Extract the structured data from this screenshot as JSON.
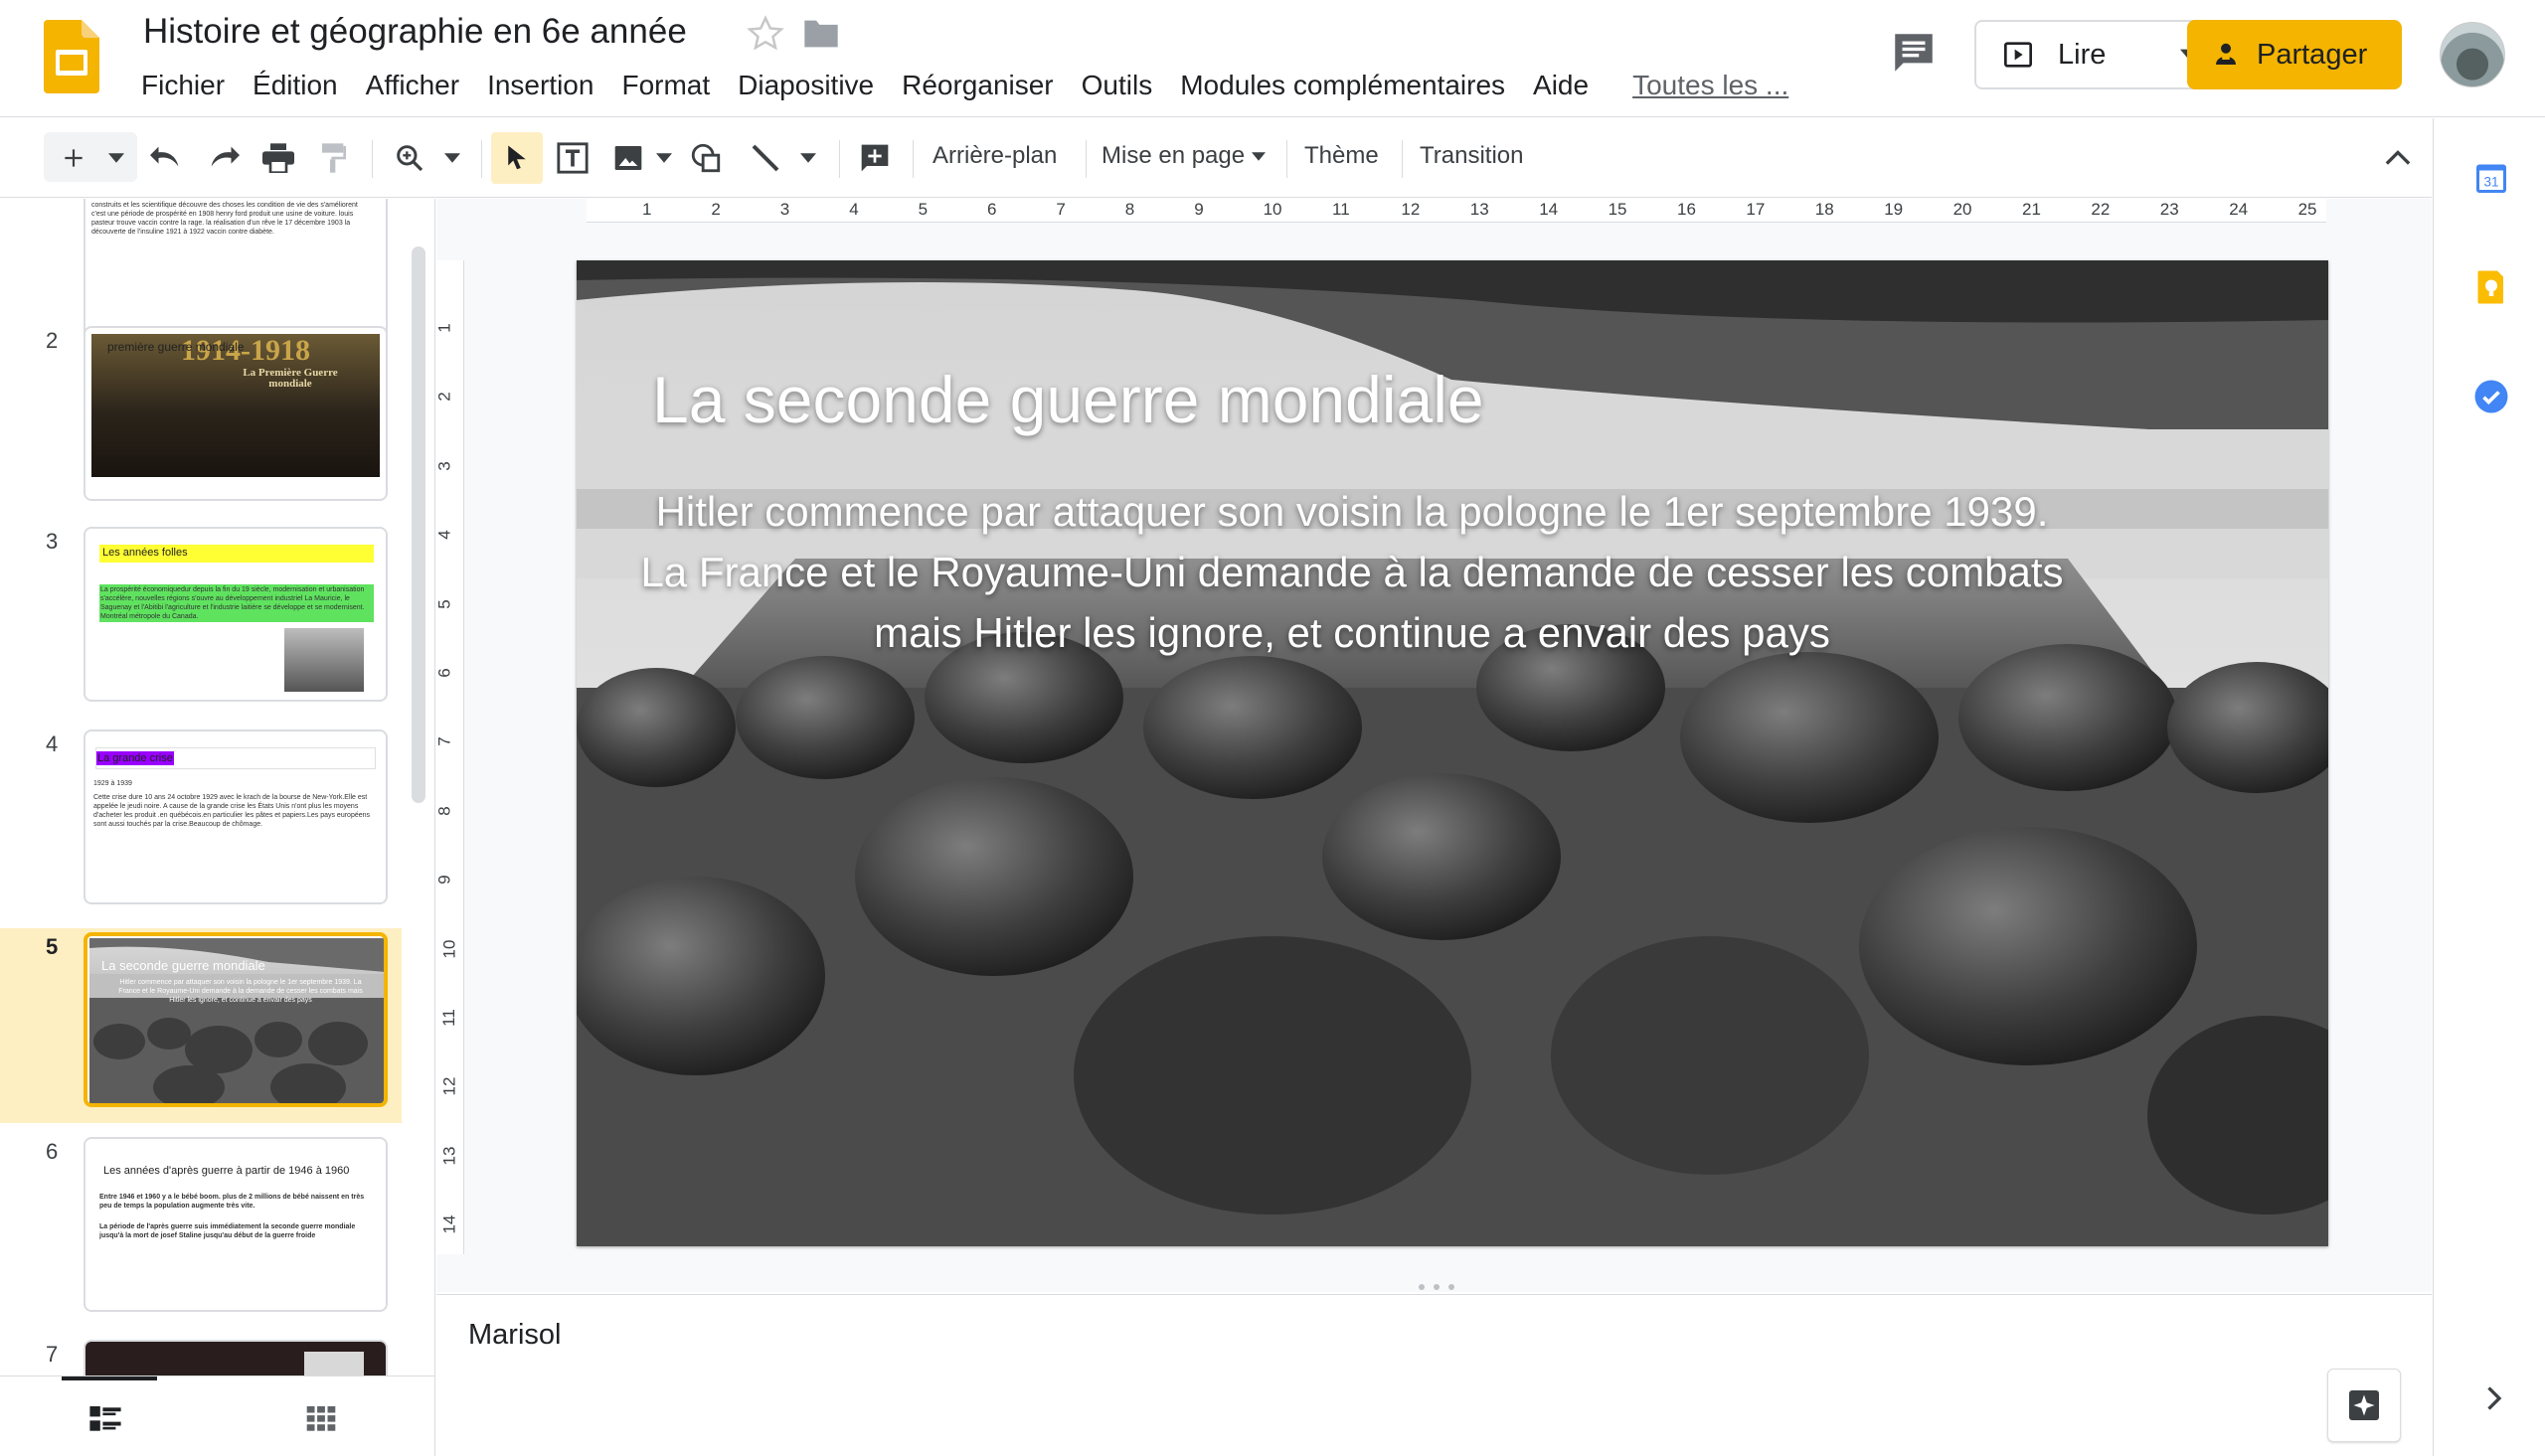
{
  "document": {
    "title": "Histoire et géographie en 6e année"
  },
  "menu": {
    "items": [
      "Fichier",
      "Édition",
      "Afficher",
      "Insertion",
      "Format",
      "Diapositive",
      "Réorganiser",
      "Outils",
      "Modules complémentaires",
      "Aide"
    ],
    "last_edit": "Toutes les ..."
  },
  "header": {
    "present_label": "Lire",
    "share_label": "Partager"
  },
  "toolbar": {
    "background_label": "Arrière-plan",
    "layout_label": "Mise en page",
    "theme_label": "Thème",
    "transition_label": "Transition"
  },
  "ruler": {
    "horizontal": [
      "1",
      "2",
      "3",
      "4",
      "5",
      "6",
      "7",
      "8",
      "9",
      "10",
      "11",
      "12",
      "13",
      "14",
      "15",
      "16",
      "17",
      "18",
      "19",
      "20",
      "21",
      "22",
      "23",
      "24",
      "25"
    ],
    "vertical": [
      "1",
      "2",
      "3",
      "4",
      "5",
      "6",
      "7",
      "8",
      "9",
      "10",
      "11",
      "12",
      "13",
      "14"
    ]
  },
  "filmstrip": {
    "slides": [
      {
        "number": "2",
        "title": "première guerre mondiale",
        "caption": "1914-1918",
        "subcaption": "La Première Guerre mondiale"
      },
      {
        "number": "3",
        "title": "Les années folles",
        "body": "La prospérité économiquedur depuis la fin du 19 siècle, modernisation et urbanisation s'accélère, nouvelles régions s'ouvre au développement industriel La Mauricie, le Saguenay et l'Abitibi l'agriculture et l'industrie laitière se développe et se modernisent. Montréal métropole du Canada."
      },
      {
        "number": "4",
        "title": "La grande crise",
        "subtitle": "1929 à 1939",
        "body": "Cette crise dure 10 ans 24 octobre 1929 avec le krach de la bourse de New-York.Elle est appelée le jeudi noire. A cause de la grande crise les États Unis n'ont plus les moyens d'acheter les produit .en québécois.en particulier les pâtes et papiers.Les pays européens sont aussi touchés par la crise.Beaucoup de chômage."
      },
      {
        "number": "5",
        "title": "La seconde guerre mondiale",
        "body": "Hitler commence par attaquer son voisin la pologne le 1er septembre 1939. La France et le Royaume-Uni demande à la demande de cesser les combats mais Hitler les ignore, et continue a envair des pays"
      },
      {
        "number": "6",
        "title": "Les années d'après guerre à partir de 1946 à 1960",
        "body1": "Entre 1946 et 1960 y a le bébé boom. plus de 2 millions de bébé naissent en très peu de temps la population augmente très vite.",
        "body2": "La période de l'après guerre suis immédiatement la seconde guerre mondiale jusqu'à la mort de josef Staline jusqu'au début de la guerre froide"
      },
      {
        "number": "7"
      }
    ],
    "top_partial_text": "construits et les scientifique découvre des choses les condition de vie des s'améliorent c'est une période de prospérité en 1908 henry ford produit une usine de voiture. louis pasteur trouve vaccin contre la rage. la réalisation d'un rêve le 17 décembre 1903 la découverte de l'insuline 1921 à 1922 vaccin contre diabète."
  },
  "slide": {
    "title": "La seconde guerre mondiale",
    "body": "Hitler commence par attaquer son voisin la pologne le 1er septembre 1939. La France et le Royaume-Uni demande à la demande de cesser les combats mais Hitler les ignore, et continue a envair des pays"
  },
  "notes": {
    "text": "Marisol"
  },
  "colors": {
    "accent": "#f4b400",
    "selection_bg": "#feefc3",
    "slides_logo": "#f4b400"
  }
}
